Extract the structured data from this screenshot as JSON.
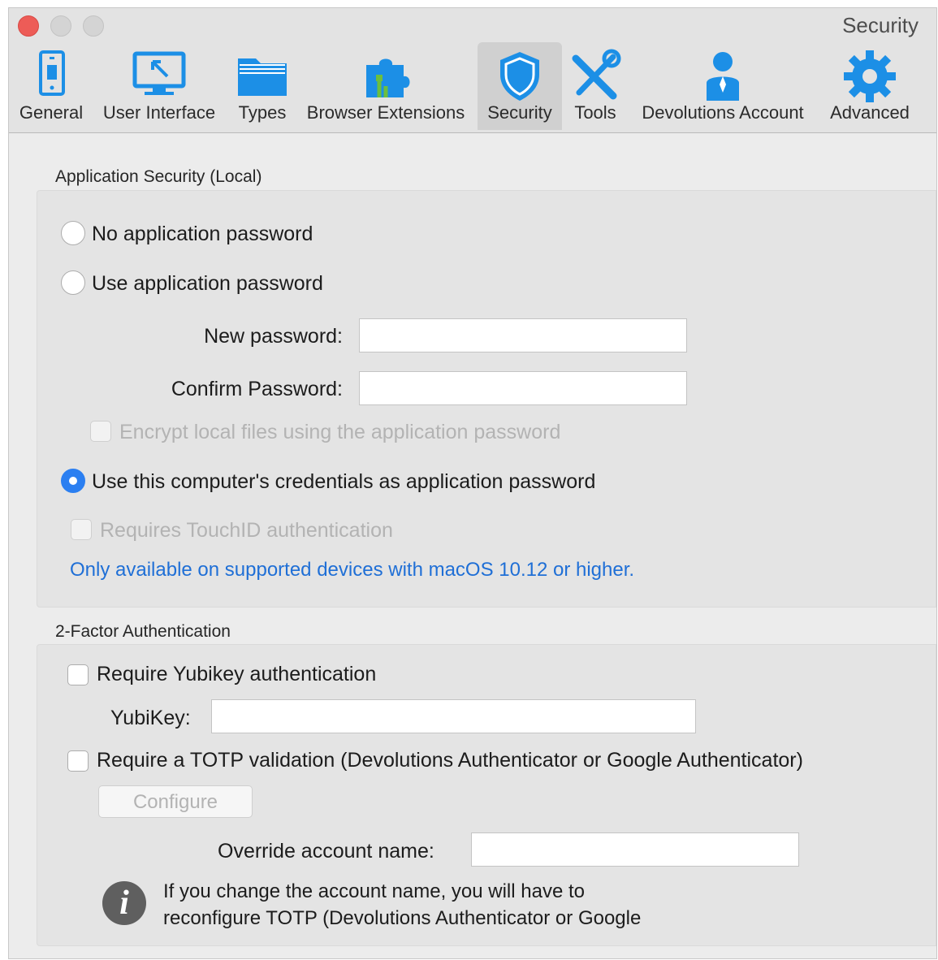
{
  "window": {
    "title": "Security"
  },
  "tabs": [
    {
      "label": "General",
      "icon": "phone-icon"
    },
    {
      "label": "User Interface",
      "icon": "monitor-icon"
    },
    {
      "label": "Types",
      "icon": "folder-icon"
    },
    {
      "label": "Browser Extensions",
      "icon": "puzzle-piece-icon"
    },
    {
      "label": "Security",
      "icon": "shield-icon"
    },
    {
      "label": "Tools",
      "icon": "tools-icon"
    },
    {
      "label": "Devolutions Account",
      "icon": "user-icon"
    },
    {
      "label": "Advanced",
      "icon": "gear-icon"
    }
  ],
  "selected_tab": "Security",
  "app_security": {
    "title": "Application Security (Local)",
    "no_password_label": "No application password",
    "use_password_label": "Use application password",
    "new_password_label": "New password:",
    "new_password_value": "",
    "confirm_password_label": "Confirm Password:",
    "confirm_password_value": "",
    "encrypt_label": "Encrypt local files using the application password",
    "encrypt_checked": false,
    "computer_credentials_label": "Use this computer's credentials as application password",
    "selected_option": "computer_credentials",
    "touchid_label": "Requires TouchID authentication",
    "touchid_checked": false,
    "note": "Only available on supported devices with macOS 10.12 or higher."
  },
  "two_factor": {
    "title": "2-Factor Authentication",
    "yubikey_require_label": "Require Yubikey authentication",
    "yubikey_checked": false,
    "yubikey_label": "YubiKey:",
    "yubikey_value": "",
    "totp_label": "Require a TOTP validation (Devolutions Authenticator or Google Authenticator)",
    "totp_checked": false,
    "configure_label": "Configure",
    "override_label": "Override account name:",
    "override_value": "",
    "info_line1": "If you change the account name, you will have to",
    "info_line2": "reconfigure TOTP (Devolutions Authenticator or Google"
  },
  "colors": {
    "accent": "#2b7ff1",
    "note_blue": "#1f6fd6",
    "close_button": "#ed5c57",
    "icon_blue": "#1c8fe6",
    "icon_green": "#6cbf3e"
  }
}
